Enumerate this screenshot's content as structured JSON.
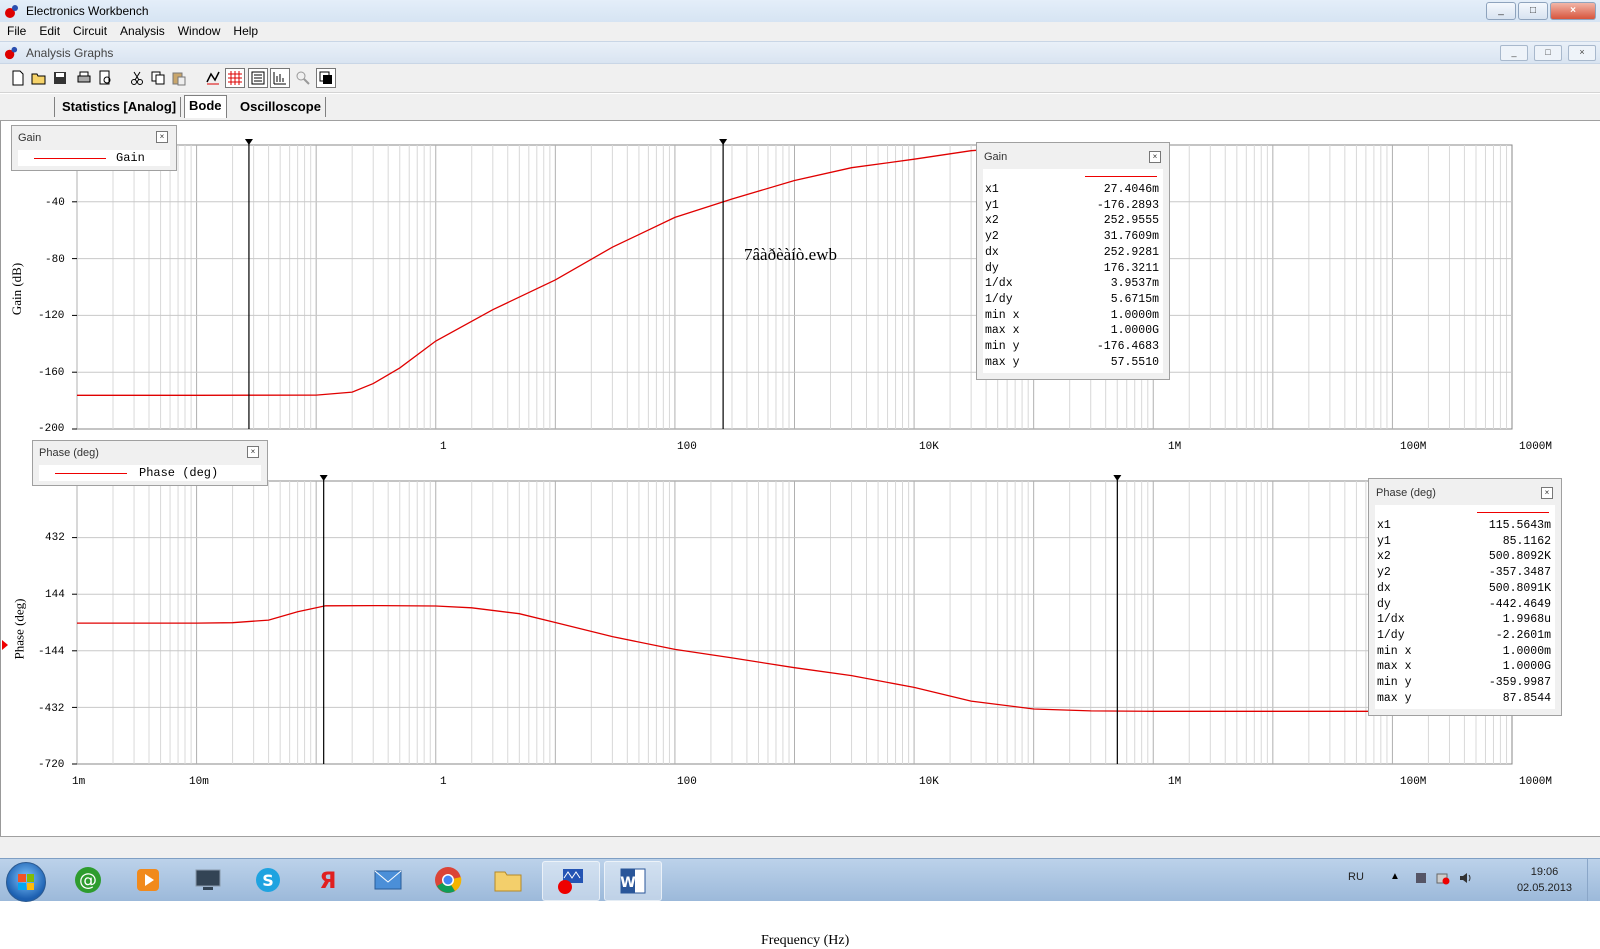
{
  "window": {
    "title": "Electronics Workbench",
    "controls": [
      "_",
      "□",
      "×"
    ]
  },
  "menu": [
    "File",
    "Edit",
    "Circuit",
    "Analysis",
    "Window",
    "Help"
  ],
  "child_window": {
    "title": "Analysis Graphs"
  },
  "toolbar": {
    "icons": [
      "new-icon",
      "open-icon",
      "save-icon",
      "print-icon",
      "print-preview-icon",
      "cut-icon",
      "copy-icon",
      "paste-icon",
      "toggle-cursors-icon",
      "toggle-grid-icon",
      "toggle-legend-icon",
      "properties-icon",
      "zoom-icon",
      "reverse-colors-icon"
    ]
  },
  "tabs": [
    "Statistics [Analog]",
    "Bode",
    "Oscilloscope"
  ],
  "active_tab": "Bode",
  "graph": {
    "file_title": "7âàðèàíò.ewb",
    "x_axis_title": "Frequency (Hz)",
    "x_ticks_top": [
      "1",
      "100",
      "10K",
      "1M",
      "100M",
      "1000M"
    ],
    "x_ticks_bottom": [
      "1m",
      "10m",
      "1",
      "100",
      "10K",
      "1M",
      "100M",
      "1000M"
    ]
  },
  "chart_data": [
    {
      "type": "line",
      "title": "7âàðèàíò.ewb",
      "xlabel": "Frequency (Hz)",
      "ylabel": "Gain (dB)",
      "x_scale": "log",
      "xlim": [
        0.001,
        1000000000
      ],
      "ylim": [
        -200,
        0
      ],
      "y_ticks": [
        "-40",
        "-80",
        "-120",
        "-160",
        "-200"
      ],
      "grid": true,
      "legend": "top-left",
      "series": [
        {
          "name": "Gain",
          "color": "#e00000",
          "x": [
            0.001,
            0.01,
            0.1,
            0.2,
            0.3,
            0.5,
            1,
            3,
            10,
            30,
            100,
            300,
            1000,
            3000,
            10000,
            30000,
            100000
          ],
          "y": [
            -176.3,
            -176.3,
            -176.1,
            -174,
            -168,
            -157,
            -138,
            -116,
            -95,
            -72,
            -51,
            -38,
            -25,
            -16,
            -10,
            -4,
            -1
          ]
        }
      ],
      "cursors": {
        "title": "Gain",
        "rows": [
          [
            "x1",
            "27.4046m"
          ],
          [
            "y1",
            "-176.2893"
          ],
          [
            "x2",
            "252.9555"
          ],
          [
            "y2",
            "31.7609m"
          ],
          [
            "dx",
            "252.9281"
          ],
          [
            "dy",
            "176.3211"
          ],
          [
            "1/dx",
            "3.9537m"
          ],
          [
            "1/dy",
            "5.6715m"
          ],
          [
            "min x",
            "1.0000m"
          ],
          [
            "max x",
            "1.0000G"
          ],
          [
            "min y",
            "-176.4683"
          ],
          [
            "max y",
            "57.5510"
          ]
        ]
      }
    },
    {
      "type": "line",
      "xlabel": "Frequency (Hz)",
      "ylabel": "Phase (deg)",
      "x_scale": "log",
      "xlim": [
        0.001,
        1000000000
      ],
      "ylim": [
        -720,
        720
      ],
      "y_ticks": [
        "432",
        "144",
        "-144",
        "-432",
        "-720"
      ],
      "grid": true,
      "legend": "top-left",
      "series": [
        {
          "name": "Phase (deg)",
          "color": "#e00000",
          "x": [
            0.001,
            0.01,
            0.02,
            0.04,
            0.07,
            0.12,
            0.3,
            1,
            2,
            5,
            10,
            30,
            100,
            300,
            1000,
            3000,
            10000,
            30000,
            100000,
            300000,
            1000000,
            10000000,
            1000000000
          ],
          "y": [
            -3,
            -3,
            -1,
            12,
            55,
            85,
            86,
            84,
            75,
            45,
            0,
            -72,
            -137,
            -180,
            -230,
            -270,
            -330,
            -400,
            -440,
            -450,
            -452,
            -452,
            -452
          ]
        }
      ],
      "cursors": {
        "title": "Phase (deg)",
        "rows": [
          [
            "x1",
            "115.5643m"
          ],
          [
            "y1",
            "85.1162"
          ],
          [
            "x2",
            "500.8092K"
          ],
          [
            "y2",
            "-357.3487"
          ],
          [
            "dx",
            "500.8091K"
          ],
          [
            "dy",
            "-442.4649"
          ],
          [
            "1/dx",
            "1.9968u"
          ],
          [
            "1/dy",
            "-2.2601m"
          ],
          [
            "min x",
            "1.0000m"
          ],
          [
            "max x",
            "1.0000G"
          ],
          [
            "min y",
            "-359.9987"
          ],
          [
            "max y",
            "87.8544"
          ]
        ]
      }
    }
  ],
  "taskbar": {
    "apps": [
      "start-orb",
      "agent-icon",
      "media-player-icon",
      "kmplayer-icon",
      "skype-icon",
      "yandex-icon",
      "mail-icon",
      "chrome-icon",
      "explorer-icon",
      "workbench-icon",
      "word-icon"
    ],
    "lang": "RU",
    "time": "19:06",
    "date": "02.05.2013"
  }
}
